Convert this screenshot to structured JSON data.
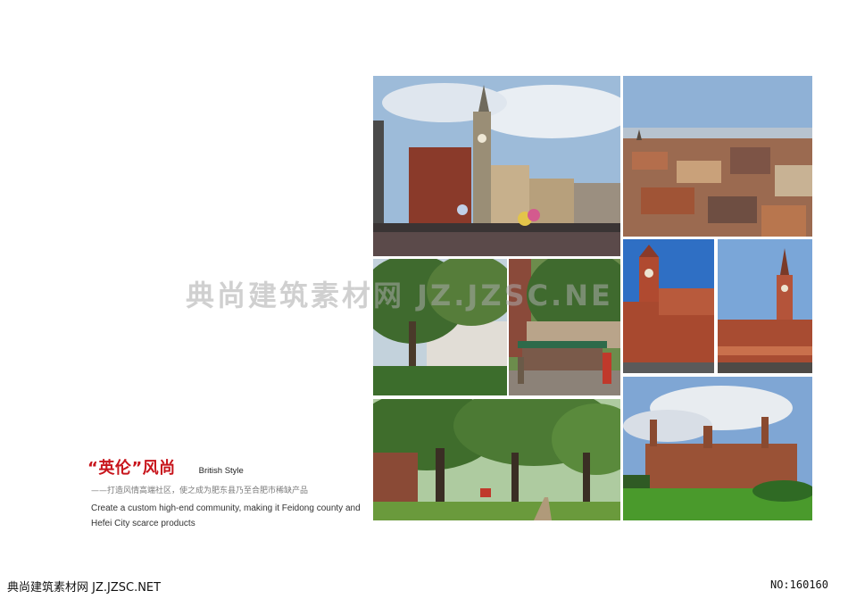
{
  "heading": {
    "title_cn": "“英伦”风尚",
    "title_en": "British  Style",
    "subtitle_cn": "——打造风情高端社区，使之成为肥东县乃至合肥市稀缺产品",
    "description_en": "Create a custom high-end community, making it Feidong county and Hefei City scarce products"
  },
  "watermarks": {
    "center": "典尚建筑素材网  JZ.JZSC.NE",
    "bottom_left": "典尚建筑素材网 JZ.JZSC.NET",
    "bottom_right": "NO:160160"
  },
  "colors": {
    "title_red": "#c8161d",
    "sky": "#8fb4d8",
    "foliage": "#4c7a34",
    "brick": "#a4523a"
  }
}
